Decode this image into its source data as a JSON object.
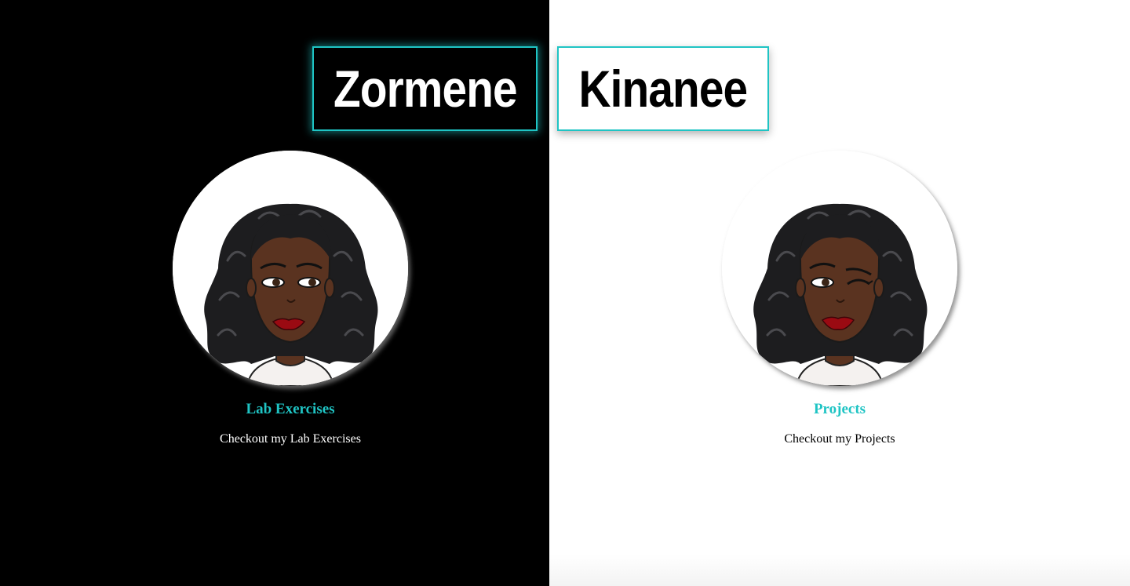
{
  "left": {
    "name": "Zormene",
    "card_title": "Lab Exercises",
    "card_description": "Checkout my Lab Exercises",
    "avatar_icon": "avatar-smiling-icon"
  },
  "right": {
    "name": "Kinanee",
    "card_title": "Projects",
    "card_description": "Checkout my Projects",
    "avatar_icon": "avatar-winking-icon"
  },
  "colors": {
    "accent": "#1fc4c4",
    "left_background": "#000000",
    "right_background": "#ffffff"
  }
}
